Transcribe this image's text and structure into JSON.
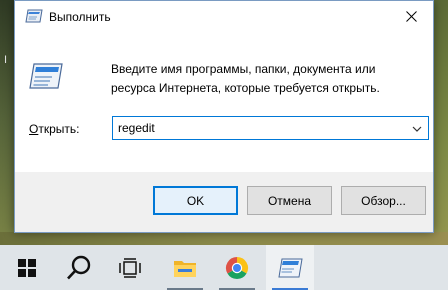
{
  "desktop": {
    "left_fragment": "I"
  },
  "dialog": {
    "title": "Выполнить",
    "description": "Введите имя программы, папки, документа или ресурса Интернета, которые требуется открыть.",
    "open_label_hotkey": "О",
    "open_label_rest": "ткрыть:",
    "combo_value": "regedit",
    "ok_label": "OK",
    "cancel_label": "Отмена",
    "browse_label": "Обзор..."
  },
  "taskbar": {
    "items": [
      "start-icon",
      "search-icon",
      "task-view-icon",
      "file-explorer-icon",
      "chrome-icon",
      "run-icon"
    ]
  },
  "colors": {
    "accent": "#0078d7",
    "taskbar": "#dfe4e8"
  }
}
